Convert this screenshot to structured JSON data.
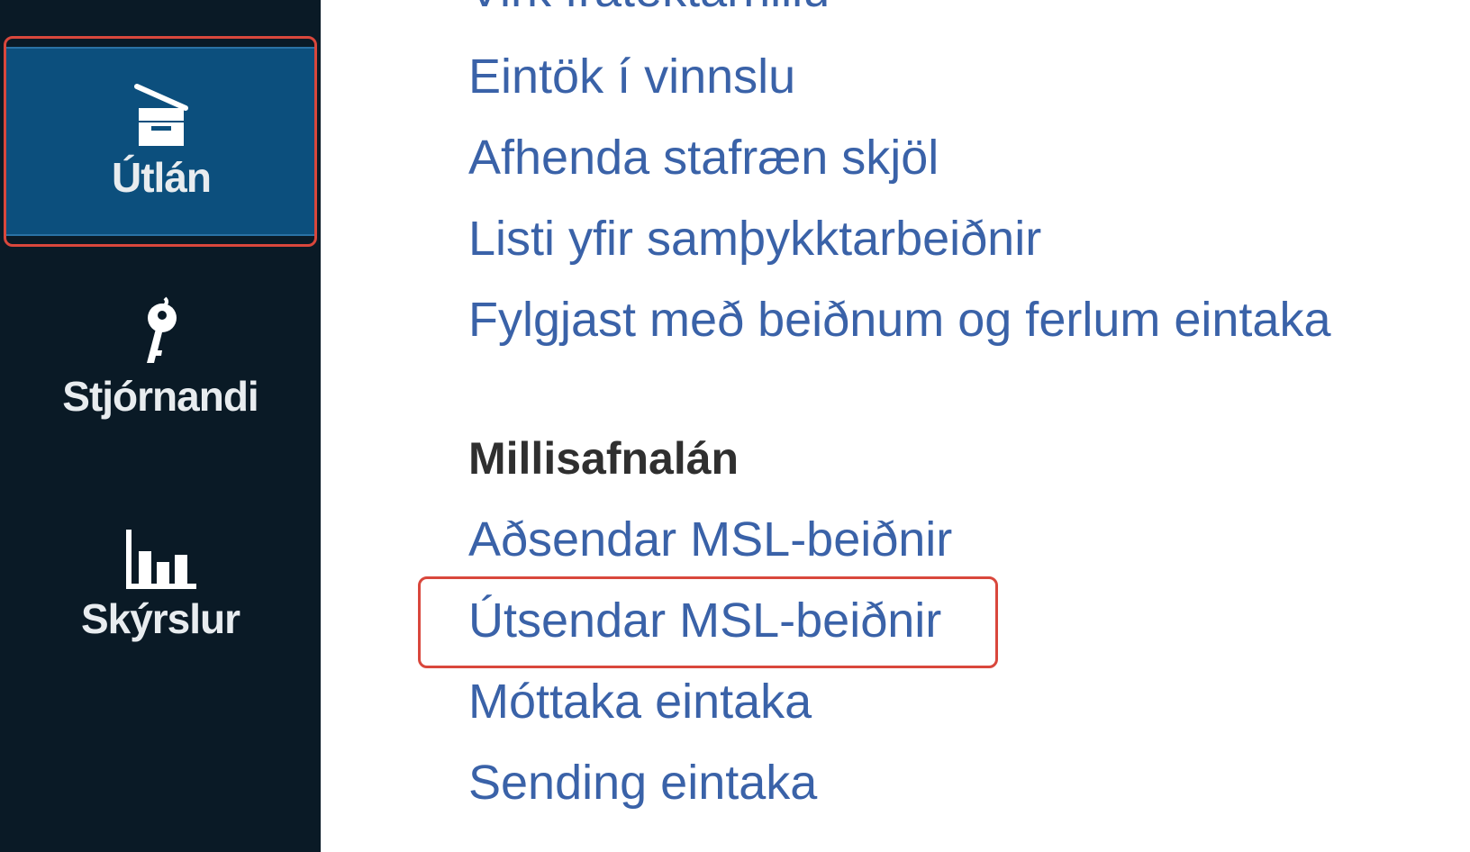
{
  "sidebar": {
    "items": [
      {
        "label": "Útlán",
        "icon": "checkout-box-icon",
        "active": true
      },
      {
        "label": "Stjórnandi",
        "icon": "key-icon",
        "active": false
      },
      {
        "label": "Skýrslur",
        "icon": "bar-chart-icon",
        "active": false
      }
    ],
    "colors": {
      "background": "#0a1a26",
      "active_background": "#0c4f7d",
      "highlight": "#d9473c"
    }
  },
  "main": {
    "links_top": [
      "Virk frátektarhillu",
      "Eintök í vinnslu",
      "Afhenda stafræn skjöl",
      "Listi yfir samþykktarbeiðnir",
      "Fylgjast með beiðnum og ferlum eintaka"
    ],
    "section_heading": "Millisafnalán",
    "links_section": [
      "Aðsendar MSL-beiðnir",
      "Útsendar MSL-beiðnir",
      "Móttaka eintaka",
      "Sending eintaka"
    ],
    "colors": {
      "link": "#3a62a8",
      "heading": "#2f2f2f"
    }
  }
}
